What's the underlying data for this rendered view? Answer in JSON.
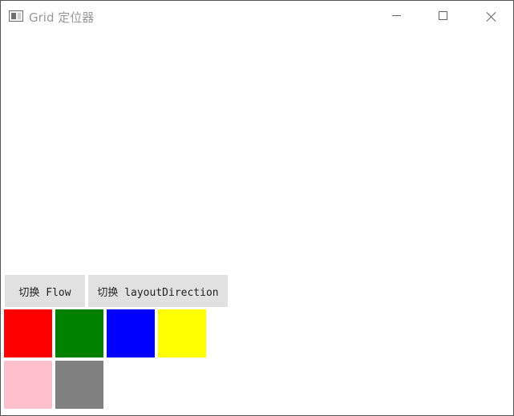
{
  "window": {
    "title": "Grid 定位器",
    "icon": "window-app-icon",
    "controls": {
      "minimize": "minimize-icon",
      "maximize": "maximize-icon",
      "close": "close-icon"
    }
  },
  "toolbar": {
    "toggle_flow_label": "切换 Flow",
    "toggle_layout_direction_label": "切换 layoutDirection"
  },
  "grid": {
    "cells": [
      {
        "color": "#ff0000"
      },
      {
        "color": "#008000"
      },
      {
        "color": "#0000ff"
      },
      {
        "color": "#ffff00"
      },
      {
        "color": "#ffc0cb"
      },
      {
        "color": "#808080"
      }
    ]
  }
}
